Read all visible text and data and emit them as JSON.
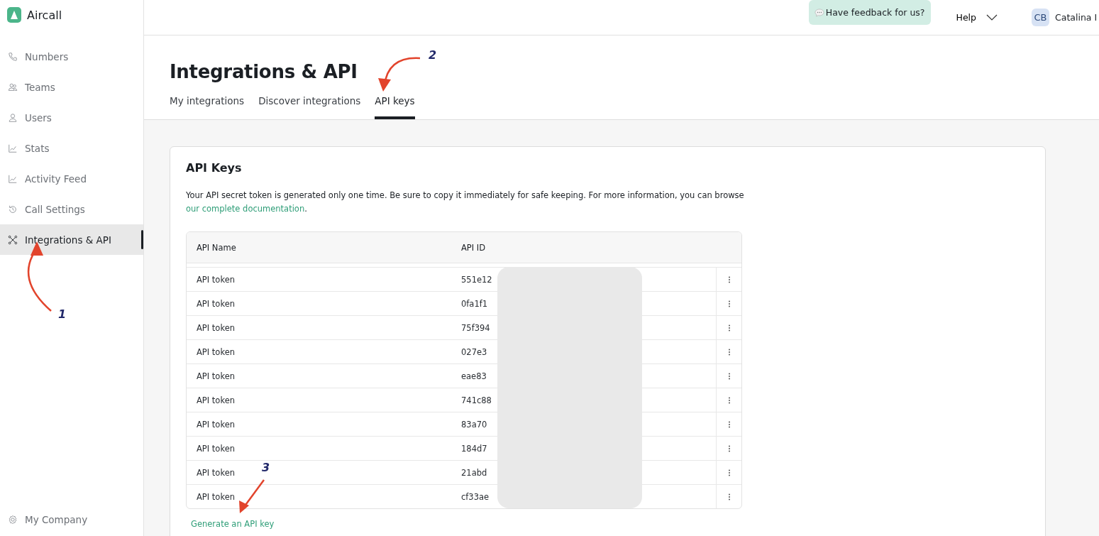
{
  "brand": {
    "name": "Aircall"
  },
  "sidebar": {
    "items": [
      {
        "label": "Numbers",
        "selected": false
      },
      {
        "label": "Teams",
        "selected": false
      },
      {
        "label": "Users",
        "selected": false
      },
      {
        "label": "Stats",
        "selected": false
      },
      {
        "label": "Activity Feed",
        "selected": false
      },
      {
        "label": "Call Settings",
        "selected": false
      },
      {
        "label": "Integrations & API",
        "selected": true
      }
    ],
    "footer": {
      "label": "My Company"
    }
  },
  "topbar": {
    "feedback": "Have feedback for us?",
    "help": "Help",
    "avatar": "CB",
    "user": "Catalina I"
  },
  "page": {
    "title": "Integrations & API",
    "tabs": [
      {
        "label": "My integrations",
        "selected": false
      },
      {
        "label": "Discover integrations",
        "selected": false
      },
      {
        "label": "API keys",
        "selected": true
      }
    ]
  },
  "card": {
    "title": "API Keys",
    "description": "Your API secret token is generated only one time. Be sure to copy it immediately for safe keeping. For more information, you can browse",
    "link": "our complete documentation",
    "after_link": ".",
    "table": {
      "columns": [
        "API Name",
        "API ID"
      ],
      "rows": [
        {
          "name": "API token",
          "id": "551e12"
        },
        {
          "name": "API token",
          "id": "0fa1f1"
        },
        {
          "name": "API token",
          "id": "75f394"
        },
        {
          "name": "API token",
          "id": "027e3"
        },
        {
          "name": "API token",
          "id": "eae83"
        },
        {
          "name": "API token",
          "id": "741c88"
        },
        {
          "name": "API token",
          "id": "83a70"
        },
        {
          "name": "API token",
          "id": "184d7"
        },
        {
          "name": "API token",
          "id": "21abd"
        },
        {
          "name": "API token",
          "id": "cf33ae"
        }
      ]
    },
    "action": "Generate an API key"
  },
  "annotations": [
    {
      "label": "1"
    },
    {
      "label": "2"
    },
    {
      "label": "3"
    }
  ]
}
